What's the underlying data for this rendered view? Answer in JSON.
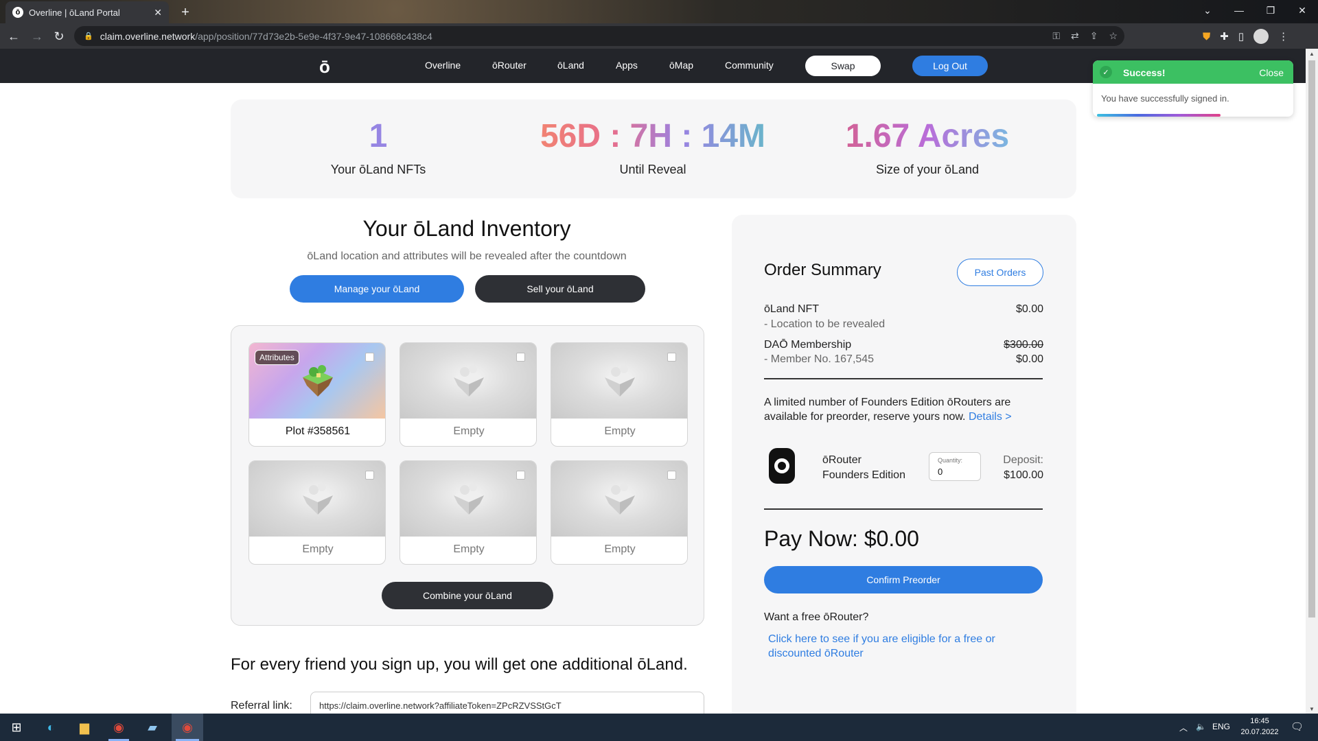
{
  "browser": {
    "tab_title": "Overline | ōLand Portal",
    "tab_favicon": "ō",
    "url_host": "claim.overline.network",
    "url_path": "/app/position/77d73e2b-5e9e-4f37-9e47-108668c438c4"
  },
  "nav": {
    "logo": "ō",
    "links": [
      "Overline",
      "ōRouter",
      "ōLand",
      "Apps",
      "ōMap",
      "Community"
    ],
    "swap": "Swap",
    "logout": "Log Out"
  },
  "stats": {
    "nfts_value": "1",
    "nfts_label": "Your ōLand NFTs",
    "reveal_value": "56D : 7H : 14M",
    "reveal_label": "Until Reveal",
    "size_value": "1.67 Acres",
    "size_label": "Size of your ōLand"
  },
  "inventory": {
    "title": "Your ōLand Inventory",
    "subtitle": "ōLand location and attributes will be revealed after the countdown",
    "manage_button": "Manage your ōLand",
    "sell_button": "Sell your ōLand",
    "combine_button": "Combine your ōLand",
    "attributes_badge": "Attributes",
    "cards": [
      {
        "label": "Plot #358561"
      },
      {
        "label": "Empty"
      },
      {
        "label": "Empty"
      },
      {
        "label": "Empty"
      },
      {
        "label": "Empty"
      },
      {
        "label": "Empty"
      }
    ]
  },
  "referral": {
    "headline": "For every friend you sign up, you will get one additional ōLand.",
    "label": "Referral link:",
    "value": "https://claim.overline.network?affiliateToken=ZPcRZVSStGcT"
  },
  "order": {
    "title": "Order Summary",
    "past_orders": "Past Orders",
    "nft_label": "ōLand NFT",
    "nft_price": "$0.00",
    "nft_sub": "- Location to be revealed",
    "dao_label": "DAŌ Membership",
    "dao_old_price": "$300.00",
    "dao_sub": "- Member No. 167,545",
    "dao_price": "$0.00",
    "limited_text": "A limited number of Founders Edition ōRouters are available for preorder, reserve yours now.",
    "details_link": "Details >",
    "router_name_1": "ōRouter",
    "router_name_2": "Founders Edition",
    "quantity_label": "Quantity:",
    "quantity_value": "0",
    "deposit_label": "Deposit:",
    "deposit_value": "$100.00",
    "pay_now": "Pay Now: $0.00",
    "confirm_button": "Confirm Preorder",
    "free_question": "Want a free ōRouter?",
    "free_link": "Click here to see if you are eligible for a free or discounted ōRouter"
  },
  "toast": {
    "title": "Success!",
    "close": "Close",
    "message": "You have successfully signed in."
  },
  "taskbar": {
    "language": "ENG",
    "time": "16:45",
    "date": "20.07.2022"
  }
}
